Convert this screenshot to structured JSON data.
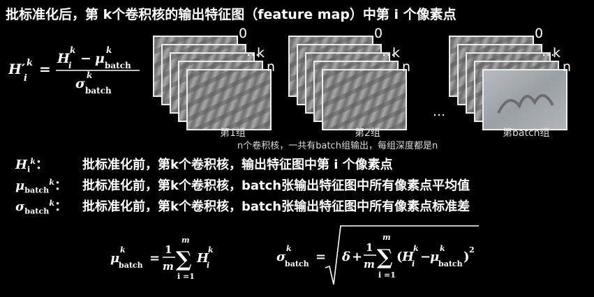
{
  "title": "批标准化后，第 k个卷积核的输出特征图（feature map）中第 i 个像素点",
  "groups": [
    {
      "label": "第1组",
      "top_index": "0",
      "mid_index": "k",
      "bottom_index": "n",
      "dots": "…"
    },
    {
      "label": "第2组",
      "top_index": "0",
      "mid_index": "k",
      "bottom_index": "n",
      "dots": "…"
    },
    {
      "label": "第batch组",
      "top_index": "0",
      "mid_index": "k",
      "bottom_index": "n",
      "dots": "…"
    }
  ],
  "group_ellipsis": "…",
  "caption": "n个卷积核，一共有batch组输出，每组深度都是n",
  "definitions": [
    {
      "symbol": "H",
      "sub": "i",
      "sup": "k",
      "colon": "：",
      "text": "批标准化前，第k个卷积核，输出特征图中第 i 个像素点"
    },
    {
      "symbol": "μ",
      "sub": "batch",
      "sup": "k",
      "colon": "：",
      "text": "批标准化前，第k个卷积核，batch张输出特征图中所有像素点平均值"
    },
    {
      "symbol": "σ",
      "sub": "batch",
      "sup": "k",
      "colon": "：",
      "text": "批标准化前，第k个卷积核，batch张输出特征图中所有像素点标准差"
    }
  ],
  "formula_main": {
    "lhs": "H′",
    "lhs_sub": "i",
    "lhs_sup": "k",
    "eq": "=",
    "num_h": "H",
    "num_h_sub": "i",
    "num_h_sup": "k",
    "minus": "−",
    "num_mu": "μ",
    "num_mu_sub": "batch",
    "num_mu_sup": "k",
    "den": "σ",
    "den_sub": "batch",
    "den_sup": "k"
  },
  "formula_mean": {
    "lhs": "μ",
    "lhs_sub": "batch",
    "lhs_sup": "k",
    "eq": "=",
    "one": "1",
    "m": "m",
    "sum_top": "m",
    "sum_bottom": "i =1",
    "sigma": "∑",
    "h": "H",
    "h_sub": "i",
    "h_sup": "k"
  },
  "formula_std": {
    "lhs": "σ",
    "lhs_sub": "batch",
    "lhs_sup": "k",
    "eq": "=",
    "delta": "δ",
    "plus": "+",
    "one": "1",
    "m": "m",
    "sum_top": "m",
    "sum_bottom": "i =1",
    "sigma": "∑",
    "open": "(",
    "h": "H",
    "h_sub": "i",
    "h_sup": "k",
    "minus": "−",
    "mu": "μ",
    "mu_sub": "batch",
    "mu_sup": "k",
    "close": ")",
    "pow": "2"
  }
}
